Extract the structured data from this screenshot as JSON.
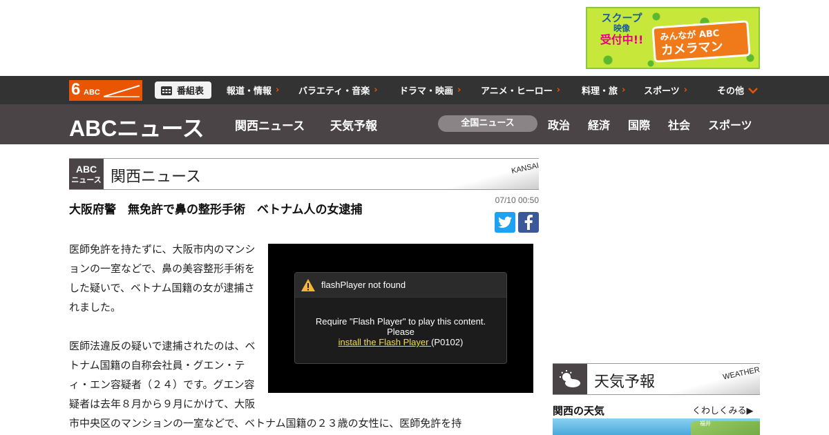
{
  "ad": {
    "line1": "スクープ",
    "line2": "映像",
    "line3": "受付中!!",
    "box_top": "みんなが ABC",
    "box_bottom": "カメラマン"
  },
  "nav1": {
    "brand_num": "6",
    "brand_abc": "ABC",
    "tv_schedule": "番組表",
    "items": [
      "報道・情報",
      "バラエティ・音楽",
      "ドラマ・映画",
      "アニメ・ヒーロー",
      "料理・旅",
      "スポーツ",
      "その他"
    ]
  },
  "nav2": {
    "logo": "ABCニュース",
    "links": [
      "関西ニュース",
      "天気予報"
    ],
    "national": "全国ニュース",
    "categories": [
      "政治",
      "経済",
      "国際",
      "社会",
      "スポーツ"
    ]
  },
  "section": {
    "emblem_top": "ABC",
    "emblem_bottom": "ニュース",
    "title": "関西ニュース",
    "english": "KANSAI"
  },
  "article": {
    "headline": "大阪府警　無免許で鼻の整形手術　ベトナム人の女逮捕",
    "timestamp": "07/10 00:50",
    "para1": "医師免許を持たずに、大阪市内のマンションの一室などで、鼻の美容整形手術をした疑いで、ベトナム国籍の女が逮捕されました。",
    "para2": "医師法違反の疑いで逮捕されたのは、ベトナム国籍の自称会社員・グエン・ティ・エン容疑者（２４）です。グエン容疑者は去年８月から９月にかけて、大阪市中央区のマンションの一室などで、ベトナム国籍の２３歳の女性に、医師免許を持"
  },
  "flash": {
    "title": "flashPlayer not found",
    "line1": "Require \"Flash Player\" to play this content.",
    "line2": "Please",
    "link": "install the Flash Player ",
    "code": "(P0102)"
  },
  "weather": {
    "header_title": "天気予報",
    "header_english": "WEATHER",
    "region_title": "関西の天気",
    "more_link": "くわしくみる▶",
    "map_city": "福井"
  },
  "colors": {
    "accent": "#ea5504",
    "nav_dark": "#333333",
    "nav_mid": "#4a4447",
    "twitter": "#1da1f2",
    "facebook": "#3b5998"
  }
}
